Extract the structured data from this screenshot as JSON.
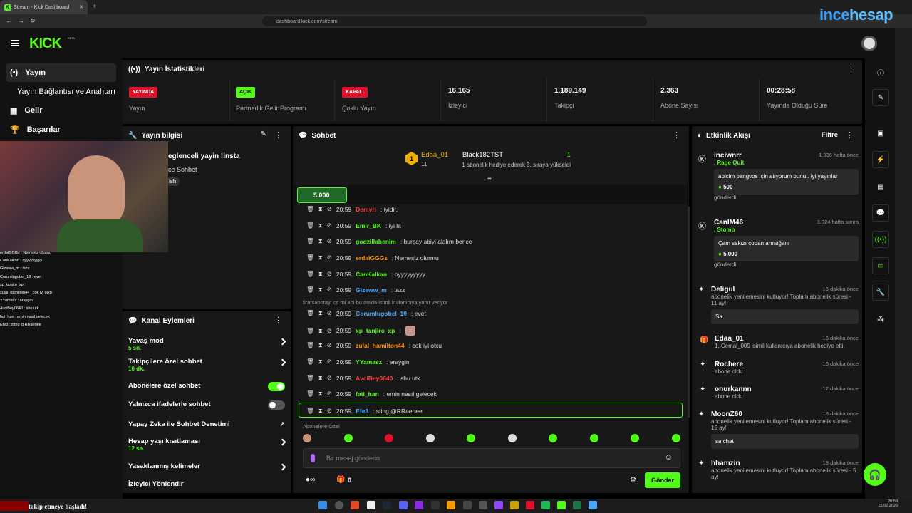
{
  "browser": {
    "tab_title": "Stream - Kick Dashboard",
    "url": "dashboard.kick.com/stream",
    "watermark_a": "ince",
    "watermark_b": "hesap"
  },
  "brand": {
    "logo": "KICK",
    "beta": "BETA",
    "accent": "#53fc18"
  },
  "nav": {
    "items": [
      {
        "label": "Yayın",
        "icon": "broadcast-icon"
      },
      {
        "label": "Yayın Bağlantısı ve Anahtarı"
      },
      {
        "label": "Gelir",
        "icon": "revenue-icon"
      },
      {
        "label": "Başarılar",
        "icon": "trophy-icon"
      }
    ]
  },
  "stats": {
    "title": "Yayın İstatistikleri",
    "items": [
      {
        "badge": "YAYINDA",
        "label": "Yayın"
      },
      {
        "badge": "AÇIK",
        "label": "Partnerlik Gelir Programı"
      },
      {
        "badge": "KAPALI",
        "label": "Çoklu Yayın"
      },
      {
        "value": "16.165",
        "label": "İzleyici"
      },
      {
        "value": "1.189.149",
        "label": "Takipçi"
      },
      {
        "value": "2.363",
        "label": "Abone Sayısı"
      },
      {
        "value": "00:28:58",
        "label": "Yayında Olduğu Süre"
      }
    ]
  },
  "stream_info": {
    "title": "Yayın bilgisi",
    "line1": "eglenceli yayin !insta",
    "line2": "ce Sohbet",
    "tag": "ish"
  },
  "chat": {
    "title": "Sohbet",
    "top_gifter": "Edaa_01",
    "top_count": "11",
    "gifter2": "Black182TST",
    "gifter2_count": "1",
    "gifter2_note": "1 abonelik hediye ederek 3. sıraya yükseldi",
    "pinned_amount": "5.000",
    "messages": [
      {
        "user": "Demyri",
        "time": "20:59",
        "text": ": iyidir,",
        "color": "#ff4040"
      },
      {
        "user": "Emir_BK",
        "time": "20:59",
        "text": ": iyi la",
        "color": "#53fc18"
      },
      {
        "user": "godzillabenim",
        "time": "20:59",
        "text": ": burçay abiyi alalım bence",
        "color": "#53fc18"
      },
      {
        "user": "erdalGGGz",
        "time": "20:59",
        "text": ": Nemesiz olurmu",
        "color": "#ff8a00"
      },
      {
        "user": "CanKalkan",
        "time": "20:59",
        "text": ": oyyyyyyyyy",
        "color": "#53fc18"
      },
      {
        "user": "Gizeww_m",
        "time": "20:59",
        "text": ": lazz",
        "color": "#4aa8ff"
      },
      {
        "user": "Corumlugobel_19",
        "time": "20:59",
        "text": ": evet",
        "color": "#4aa8ff"
      },
      {
        "user": "xp_tanjiro_xp",
        "time": "20:59",
        "text": ":",
        "color": "#53fc18"
      },
      {
        "user": "zulal_hamilton44",
        "time": "20:59",
        "text": ": cok iyi olxu",
        "color": "#ff8a00"
      },
      {
        "user": "YYamasz",
        "time": "20:59",
        "text": ": eraygin",
        "color": "#53fc18"
      },
      {
        "user": "AvciBey0640",
        "time": "20:59",
        "text": ": shu utk",
        "color": "#ff4040"
      },
      {
        "user": "fati_han",
        "time": "20:59",
        "text": ": emin nasıl gelecek",
        "color": "#53fc18"
      },
      {
        "user": "Efe3",
        "time": "20:59",
        "text": ": sting @RRaenee",
        "color": "#4aa8ff"
      }
    ],
    "reply_note": "firatsabotay: cs mi abi bu arada isimli kullanıcıya yanıt veriyor",
    "emote_bar_label": "Abonelere Özel",
    "placeholder": "Bir mesaj gönderin",
    "send": "Gönder",
    "points": "0"
  },
  "actions": {
    "title": "Kanal Eylemleri",
    "items": [
      {
        "label": "Yavaş mod",
        "sub": "5 sn."
      },
      {
        "label": "Takipçilere özel sohbet",
        "sub": "10 dk."
      },
      {
        "label": "Abonelere özel sohbet",
        "toggle": "on"
      },
      {
        "label": "Yalnızca ifadelerle sohbet",
        "toggle": "off"
      },
      {
        "label": "Yapay Zeka ile Sohbet Denetimi"
      },
      {
        "label": "Hesap yaşı kısıtlaması",
        "sub": "12 sa."
      },
      {
        "label": "Yasaklanmış kelimeler"
      },
      {
        "label": "İzleyici Yönlendir"
      }
    ]
  },
  "activity": {
    "title": "Etkinlik Akışı",
    "filter": "Filtre",
    "items": [
      {
        "name": "inciwnrr",
        "time": "1.936 hafta önce",
        "sub": ", Rage Quit",
        "msg": "abicim pangvos için atıyorum bunu.. iyi yayınlar",
        "amount": "500",
        "foot": "gönderdi"
      },
      {
        "name": "CanIM46",
        "time": "3.024 hafta sonra",
        "sub": ", Stomp",
        "msg": "Çam sakızı çoban armağanı",
        "amount": "5.000",
        "foot": "gönderdi"
      },
      {
        "name": "Deligul",
        "time": "16 dakika önce",
        "sub": "abonelik yenilemesini kutluyor! Toplam abonelik süresi - 11 ay!",
        "msg": "Sa"
      },
      {
        "name": "Edaa_01",
        "time": "16 dakika önce",
        "sub": "1, Cemal_009 isimli kullanıcıya abonelik hediye etti."
      },
      {
        "name": "Rochere",
        "time": "16 dakika önce",
        "sub": "abone oldu"
      },
      {
        "name": "onurkannn",
        "time": "17 dakika önce",
        "sub": "abone oldu"
      },
      {
        "name": "MoonZ60",
        "time": "18 dakika önce",
        "sub": "abonelik yenilemesini kutluyor! Toplam abonelik süresi - 15 ay!",
        "msg": "sa chat"
      },
      {
        "name": "hhamzin",
        "time": "18 dakika önce",
        "sub": "abonelik yenilemesini kutluyor! Toplam abonelik süresi - 5 ay!"
      }
    ]
  },
  "overlay": {
    "chat": [
      "erdalGGGz : Nemesiz olurmu",
      "CanKalkan : oyyyyyyyyy",
      "Gizeww_m : lazz",
      "Corumlugobel_19 : evet",
      "xp_tanjiro_xp :",
      "zulal_hamilton44 : cok iyi olxu",
      "YYamasz : eraygin",
      "AvciBey0640 : shu utk",
      "fati_han : emin nasıl gelecek",
      "Efe3 : sting @RRaenee"
    ],
    "bottom": "takip etmeye başladı!"
  },
  "taskbar": {
    "time": "20:59",
    "date": "15.02.2026"
  }
}
